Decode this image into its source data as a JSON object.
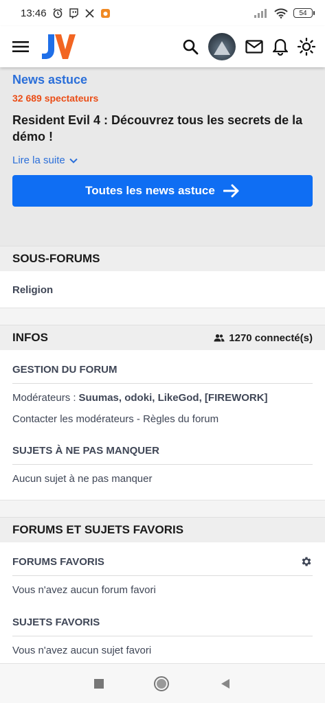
{
  "status": {
    "time": "13:46",
    "battery": "54"
  },
  "news": {
    "kicker": "News astuce",
    "viewers": "32 689 spectateurs",
    "title": "Resident Evil 4 : Découvrez tous les secrets de la démo !",
    "read_more": "Lire la suite",
    "all_button": "Toutes les news astuce"
  },
  "subforums": {
    "heading": "SOUS-FORUMS",
    "items": [
      "Religion"
    ]
  },
  "infos": {
    "heading": "INFOS",
    "connected": "1270 connecté(s)",
    "management_heading": "GESTION DU FORUM",
    "moderators_label": "Modérateurs :",
    "moderators": "Suumas, odoki, LikeGod, [FIREWORK]",
    "contact": "Contacter les modérateurs - Règles du forum",
    "must_see_heading": "SUJETS À NE PAS MANQUER",
    "must_see_empty": "Aucun sujet à ne pas manquer"
  },
  "favorites": {
    "heading": "FORUMS ET SUJETS FAVORIS",
    "forums_heading": "FORUMS FAVORIS",
    "forums_empty": "Vous n'avez aucun forum favori",
    "topics_heading": "SUJETS FAVORIS",
    "topics_empty": "Vous n'avez aucun sujet favori"
  },
  "colors": {
    "accent_blue": "#0f6ef3",
    "link_blue": "#2b6fd9",
    "viewers_orange": "#ea4d16"
  }
}
